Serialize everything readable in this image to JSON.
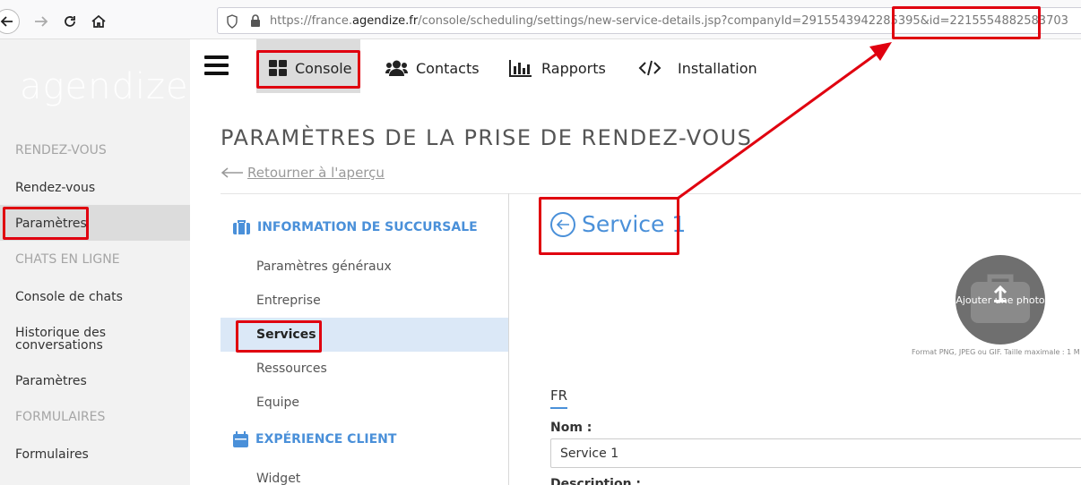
{
  "browser": {
    "url_prefix": "https://france.",
    "url_domain": "agendize.fr",
    "url_path": "/console/scheduling/settings/new-service-details.jsp?companyId=2915543942285395",
    "url_id": "&id=2215554882583703"
  },
  "sidebar": {
    "logo": "agendize",
    "sections": [
      {
        "head": "RENDEZ-VOUS",
        "items": [
          "Rendez-vous",
          "Paramètres"
        ]
      },
      {
        "head": "CHATS EN LIGNE",
        "items": [
          "Console de chats",
          "Historique des conversations",
          "Paramètres"
        ]
      },
      {
        "head": "FORMULAIRES",
        "items": [
          "Formulaires"
        ]
      }
    ]
  },
  "topnav": {
    "console": "Console",
    "contacts": "Contacts",
    "rapports": "Rapports",
    "installation": "Installation"
  },
  "main": {
    "title": "PARAMÈTRES DE LA PRISE DE RENDEZ-VOUS",
    "back_link": "Retourner à l'aperçu",
    "section1": "INFORMATION DE SUCCURSALE",
    "menu1": [
      "Paramètres généraux",
      "Entreprise",
      "Services",
      "Ressources",
      "Equipe"
    ],
    "section2": "EXPÉRIENCE CLIENT",
    "menu2": [
      "Widget"
    ],
    "service_title": "Service 1",
    "photo_label": "Ajouter une photo",
    "photo_hint": "Format PNG, JPEG ou GIF. Taille maximale : 1 M",
    "lang_tab": "FR",
    "nom_label": "Nom :",
    "nom_value": "Service 1",
    "desc_label": "Description :"
  },
  "colors": {
    "accent": "#4a90d9",
    "annotation": "#e0000f",
    "selected_bg": "#dbe8f7"
  }
}
